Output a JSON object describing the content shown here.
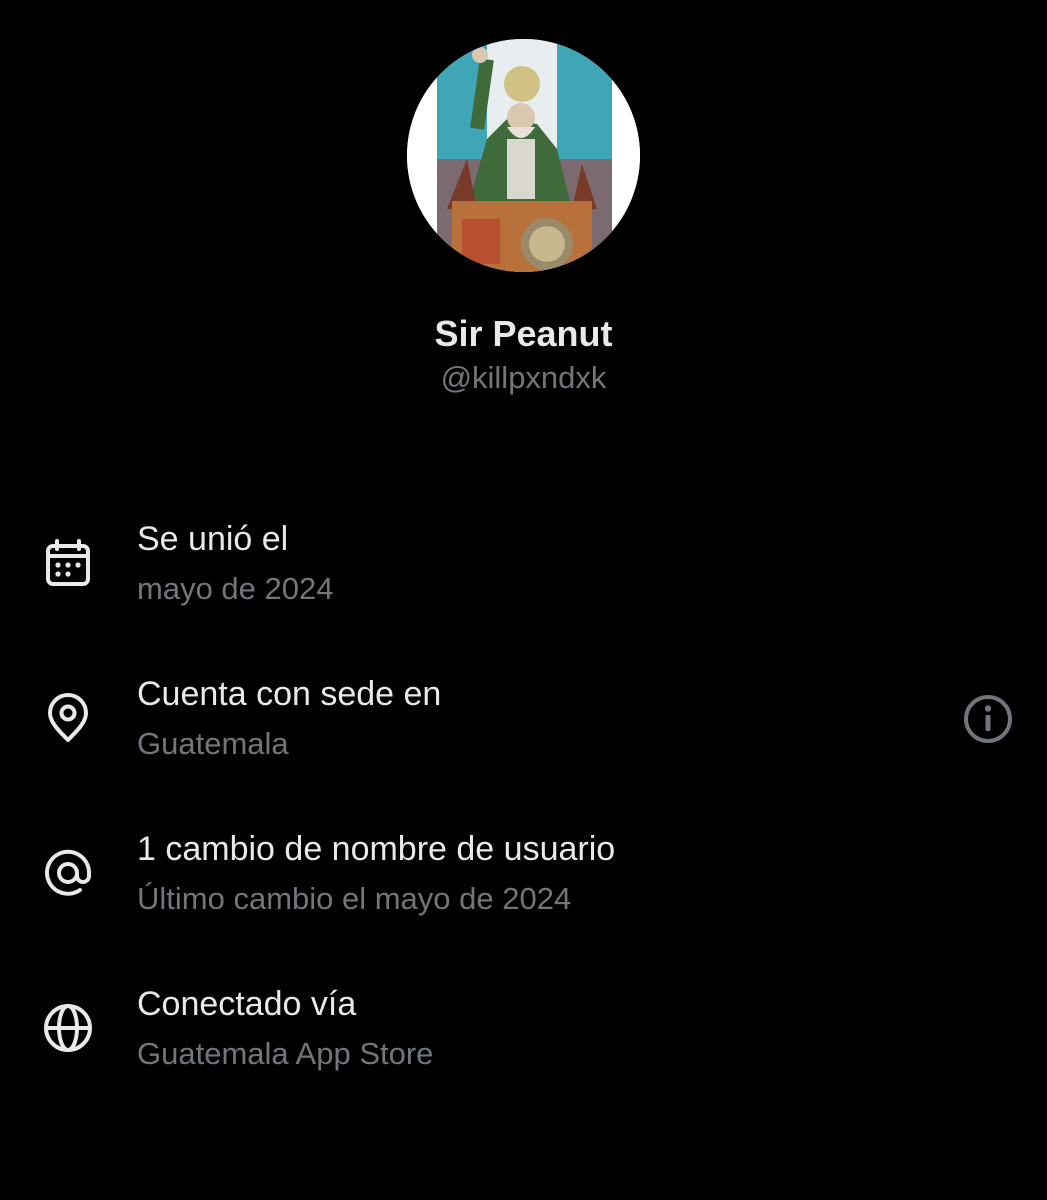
{
  "profile": {
    "display_name": "Sir Peanut",
    "handle": "@killpxndxk",
    "avatar": "profile-photo"
  },
  "rows": [
    {
      "icon": "calendar-icon",
      "title": "Se unió el",
      "subtitle": "mayo de 2024"
    },
    {
      "icon": "location-pin-icon",
      "title": "Cuenta con sede en",
      "subtitle": "Guatemala",
      "action_icon": "info-icon"
    },
    {
      "icon": "at-sign-icon",
      "title": "1 cambio de nombre de usuario",
      "subtitle": "Último cambio el mayo de 2024"
    },
    {
      "icon": "globe-icon",
      "title": "Conectado vía",
      "subtitle": "Guatemala App Store"
    }
  ],
  "colors": {
    "background": "#000000",
    "primary_text": "#e7e9ea",
    "secondary_text": "#71767b"
  }
}
